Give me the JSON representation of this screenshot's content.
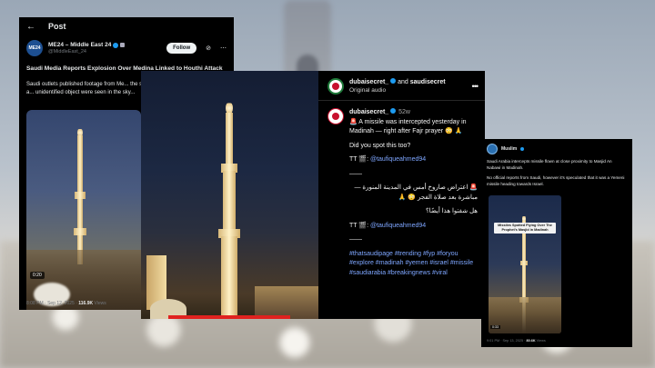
{
  "card1": {
    "top_bar": {
      "back": "←",
      "title": "Post"
    },
    "account": {
      "avatar_text": "ME24",
      "name": "ME24 – Middle East 24",
      "handle": "@MiddleEast_24"
    },
    "follow_label": "Follow",
    "title": "Saudi Media Reports Explosion Over Medina Linked to Houthi Attack",
    "body": "Saudi outlets published footage from Me... the second holiest site in Islam, where a... unidentified object were seen in the sky...",
    "video_duration": "0:20",
    "footer": {
      "time": "8:08 PM · Sep 12, 2025 · ",
      "views": "116.9K",
      "views_suffix": " Views"
    }
  },
  "card2": {
    "header": {
      "user1": "dubaisecret_",
      "and": " and ",
      "user2": "saudisecret",
      "subtitle": "Original audio",
      "more": "•••"
    },
    "post": {
      "username": "dubaisecret_",
      "ago": "52w",
      "line1": "🚨 A missile was intercepted yesterday in Madinah — right after Fajr prayer 😳 🙏",
      "line2": "Did you spot this too?",
      "tt_prefix": "TT 🎬: ",
      "mention": "@taufiqueahmed94",
      "separator": "——",
      "arabic1": "🚨 اعتراض صاروخ أمس في المدينة المنورة — مباشرة بعد صلاة الفجر 😳 🙏",
      "arabic2": "هل شفتوا هذا أيضًا؟",
      "tt_prefix2": "TT 🎬: ",
      "mention2": "@taufiqueahmed94",
      "separator2": "——",
      "hashtags": "#thatsaudipage #trending #fyp #foryou #explore #madinah #yemen #israel #missile #saudiarabia #breakingnews #viral"
    }
  },
  "card3": {
    "name": "Muslim",
    "text1": "Saudi Arabia intercepts missile flown at close proximity to Masjid An Nabawi in Madinah.",
    "text2": "No official reports from Saudi, however it's speculated that it was a Yemeni missile heading towards Israel.",
    "caption": "Missiles Spotted Flying Over The Prophet's Masjid in Madinah",
    "video_duration": "0:33",
    "footer": {
      "time": "9:01 PM · Sep 13, 2025 · ",
      "views": "80.6K",
      "views_suffix": " Views"
    }
  }
}
